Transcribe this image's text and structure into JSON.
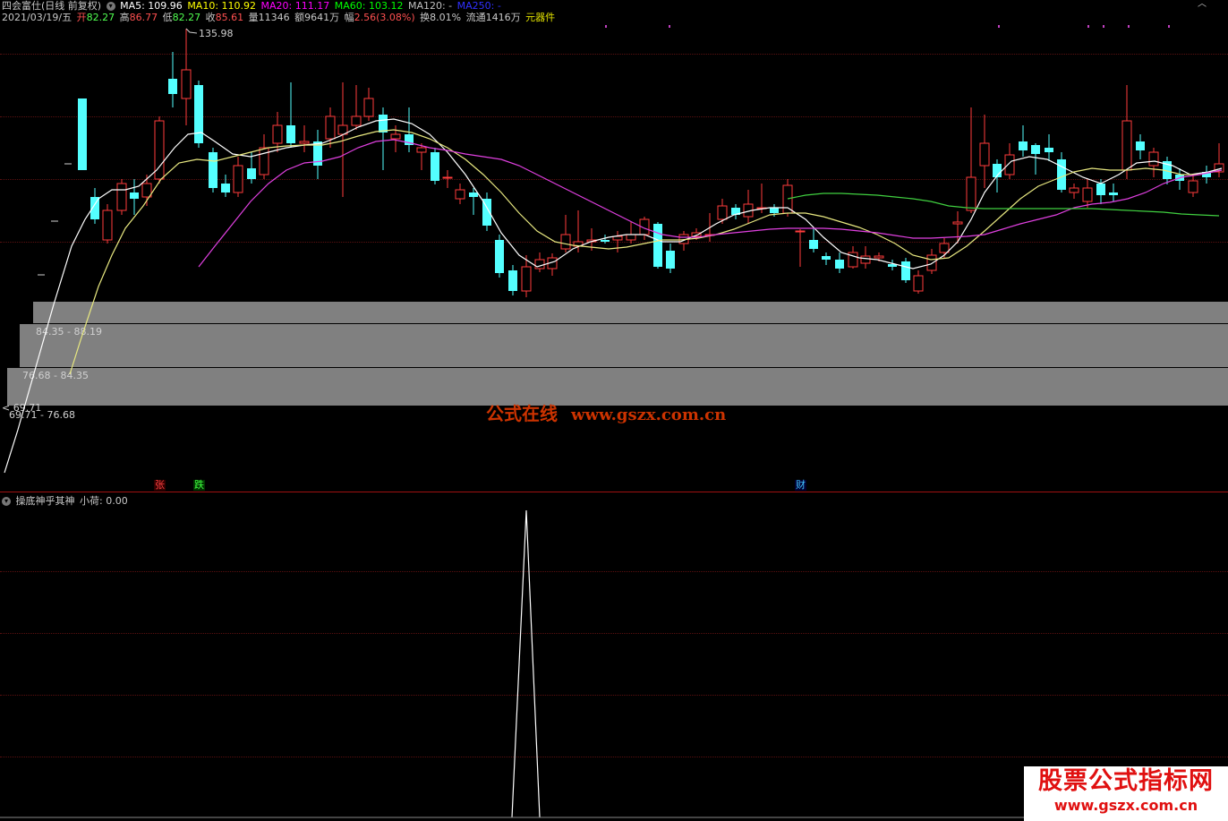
{
  "header": {
    "stock_name": "四会富仕(日线 前复权)",
    "ma5": "MA5: 109.96",
    "ma10": "MA10: 110.92",
    "ma20": "MA20: 111.17",
    "ma60": "MA60: 103.12",
    "ma120": "MA120: -",
    "ma250": "MA250: -",
    "colors": {
      "ma5": "#ffffff",
      "ma10": "#ffff00",
      "ma20": "#ff00ff",
      "ma60": "#00ff00",
      "ma120": "#c0c0c0",
      "ma250": "#0000ff"
    }
  },
  "info_bar": {
    "date": "2021/03/19/五",
    "open_label": "开",
    "open": "82.27",
    "high_label": "高",
    "high": "86.77",
    "low_label": "低",
    "low": "82.27",
    "close_label": "收",
    "close": "85.61",
    "volume": "量11346",
    "amount": "额9641万",
    "amp_label": "幅",
    "amp": "2.56(3.08%)",
    "turnover": "换8.01%",
    "float": "流通1416万",
    "sector": "元器件"
  },
  "price_labels": {
    "peak": "135.98",
    "range_top": "84.35 - 88.19",
    "range_mid": "76.68 - 84.35",
    "range_low_marker": "< 69.71",
    "range_low": "69.71 - 76.68"
  },
  "signals": {
    "zhang": "张",
    "die": "跌",
    "cai": "财"
  },
  "watermark_center": {
    "cn": "公式在线",
    "url": "www.gszx.com.cn"
  },
  "indicator": {
    "name": "操底神乎其神",
    "value": "小荷: 0.00"
  },
  "watermark_corner": {
    "title": "股票公式指标网",
    "url": "www.gszx.com.cn"
  }
}
